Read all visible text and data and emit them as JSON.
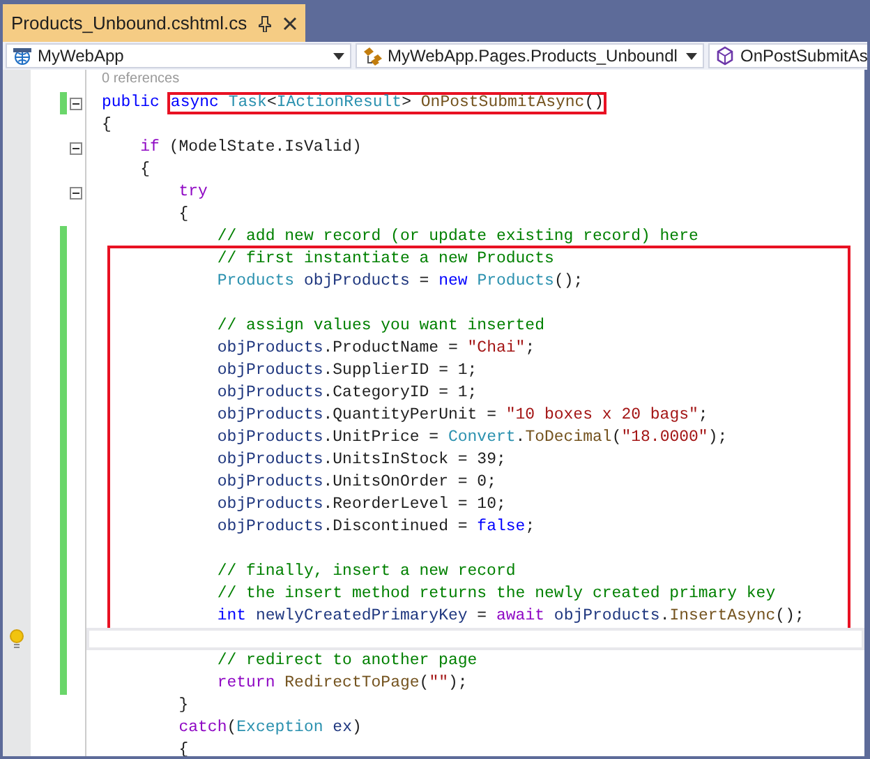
{
  "tab": {
    "title": "Products_Unbound.cshtml.cs",
    "selected": true
  },
  "navigation_bar": [
    {
      "kind": "project",
      "text": "MyWebApp"
    },
    {
      "kind": "class",
      "text": "MyWebApp.Pages.Products_Unboundl"
    },
    {
      "kind": "method",
      "text": "OnPostSubmitAs"
    }
  ],
  "code_lens": "0 references",
  "lines": [
    {
      "kind": "line",
      "changed": true,
      "foldable": true,
      "tokens": [
        {
          "kind": "kw",
          "text": "public"
        }
      ],
      "highlighted_tokens": [
        {
          "kind": "kw",
          "text": "async"
        },
        {
          "kind": "type",
          "text": " Task"
        },
        {
          "kind": "plain",
          "text": "<"
        },
        {
          "kind": "type",
          "text": "IActionResult"
        },
        {
          "kind": "plain",
          "text": "> "
        },
        {
          "kind": "method",
          "text": "OnPostSubmitAsync"
        },
        {
          "kind": "plain",
          "text": "()"
        }
      ]
    },
    {
      "kind": "line",
      "tokens": [
        {
          "kind": "plain",
          "text": "{"
        }
      ],
      "children": [
        {
          "kind": "line",
          "foldable": true,
          "tokens": [
            {
              "kind": "ctl",
              "text": "if"
            },
            {
              "kind": "plain",
              "text": " (ModelState.IsValid)"
            }
          ]
        },
        {
          "kind": "line",
          "tokens": [
            {
              "kind": "plain",
              "text": "{"
            }
          ],
          "children": [
            {
              "kind": "line",
              "foldable": true,
              "tokens": [
                {
                  "kind": "ctl",
                  "text": "try"
                }
              ]
            },
            {
              "kind": "line",
              "tokens": [
                {
                  "kind": "plain",
                  "text": "{"
                }
              ],
              "children": [
                {
                  "kind": "line",
                  "changed": true,
                  "tokens": [
                    {
                      "kind": "cmt",
                      "text": "// add new record (or update existing record) here"
                    }
                  ]
                },
                {
                  "kind": "highlight_box",
                  "children": [
                    {
                      "kind": "line",
                      "changed": true,
                      "tokens": [
                        {
                          "kind": "cmt",
                          "text": "// first instantiate a new Products"
                        }
                      ]
                    },
                    {
                      "kind": "line",
                      "changed": true,
                      "tokens": [
                        {
                          "kind": "type",
                          "text": "Products"
                        },
                        {
                          "kind": "local",
                          "text": " objProducts"
                        },
                        {
                          "kind": "plain",
                          "text": " = "
                        },
                        {
                          "kind": "kw",
                          "text": "new"
                        },
                        {
                          "kind": "type",
                          "text": " Products"
                        },
                        {
                          "kind": "plain",
                          "text": "();"
                        }
                      ]
                    },
                    {
                      "kind": "line",
                      "changed": true
                    },
                    {
                      "kind": "line",
                      "changed": true,
                      "tokens": [
                        {
                          "kind": "cmt",
                          "text": "// assign values you want inserted"
                        }
                      ]
                    },
                    {
                      "kind": "line",
                      "changed": true,
                      "tokens": [
                        {
                          "kind": "local",
                          "text": "objProducts"
                        },
                        {
                          "kind": "plain",
                          "text": ".ProductName = "
                        },
                        {
                          "kind": "str",
                          "text": "\"Chai\""
                        },
                        {
                          "kind": "plain",
                          "text": ";"
                        }
                      ]
                    },
                    {
                      "kind": "line",
                      "changed": true,
                      "tokens": [
                        {
                          "kind": "local",
                          "text": "objProducts"
                        },
                        {
                          "kind": "plain",
                          "text": ".SupplierID = 1;"
                        }
                      ]
                    },
                    {
                      "kind": "line",
                      "changed": true,
                      "tokens": [
                        {
                          "kind": "local",
                          "text": "objProducts"
                        },
                        {
                          "kind": "plain",
                          "text": ".CategoryID = 1;"
                        }
                      ]
                    },
                    {
                      "kind": "line",
                      "changed": true,
                      "tokens": [
                        {
                          "kind": "local",
                          "text": "objProducts"
                        },
                        {
                          "kind": "plain",
                          "text": ".QuantityPerUnit = "
                        },
                        {
                          "kind": "str",
                          "text": "\"10 boxes x 20 bags\""
                        },
                        {
                          "kind": "plain",
                          "text": ";"
                        }
                      ]
                    },
                    {
                      "kind": "line",
                      "changed": true,
                      "tokens": [
                        {
                          "kind": "local",
                          "text": "objProducts"
                        },
                        {
                          "kind": "plain",
                          "text": ".UnitPrice = "
                        },
                        {
                          "kind": "type",
                          "text": "Convert"
                        },
                        {
                          "kind": "plain",
                          "text": "."
                        },
                        {
                          "kind": "method",
                          "text": "ToDecimal"
                        },
                        {
                          "kind": "plain",
                          "text": "("
                        },
                        {
                          "kind": "str",
                          "text": "\"18.0000\""
                        },
                        {
                          "kind": "plain",
                          "text": ");"
                        }
                      ]
                    },
                    {
                      "kind": "line",
                      "changed": true,
                      "tokens": [
                        {
                          "kind": "local",
                          "text": "objProducts"
                        },
                        {
                          "kind": "plain",
                          "text": ".UnitsInStock = 39;"
                        }
                      ]
                    },
                    {
                      "kind": "line",
                      "changed": true,
                      "tokens": [
                        {
                          "kind": "local",
                          "text": "objProducts"
                        },
                        {
                          "kind": "plain",
                          "text": ".UnitsOnOrder = 0;"
                        }
                      ]
                    },
                    {
                      "kind": "line",
                      "changed": true,
                      "tokens": [
                        {
                          "kind": "local",
                          "text": "objProducts"
                        },
                        {
                          "kind": "plain",
                          "text": ".ReorderLevel = 10;"
                        }
                      ]
                    },
                    {
                      "kind": "line",
                      "changed": true,
                      "tokens": [
                        {
                          "kind": "local",
                          "text": "objProducts"
                        },
                        {
                          "kind": "plain",
                          "text": ".Discontinued = "
                        },
                        {
                          "kind": "kw",
                          "text": "false"
                        },
                        {
                          "kind": "plain",
                          "text": ";"
                        }
                      ]
                    },
                    {
                      "kind": "line",
                      "changed": true
                    },
                    {
                      "kind": "line",
                      "changed": true,
                      "tokens": [
                        {
                          "kind": "cmt",
                          "text": "// finally, insert a new record"
                        }
                      ]
                    },
                    {
                      "kind": "line",
                      "changed": true,
                      "tokens": [
                        {
                          "kind": "cmt",
                          "text": "// the insert method returns the newly created primary key"
                        }
                      ]
                    },
                    {
                      "kind": "line",
                      "changed": true,
                      "tokens": [
                        {
                          "kind": "kw",
                          "text": "int"
                        },
                        {
                          "kind": "local",
                          "text": " newlyCreatedPrimaryKey"
                        },
                        {
                          "kind": "plain",
                          "text": " = "
                        },
                        {
                          "kind": "ctl",
                          "text": "await"
                        },
                        {
                          "kind": "local",
                          "text": " objProducts"
                        },
                        {
                          "kind": "plain",
                          "text": "."
                        },
                        {
                          "kind": "method",
                          "text": "InsertAsync"
                        },
                        {
                          "kind": "plain",
                          "text": "();"
                        }
                      ]
                    }
                  ]
                },
                {
                  "kind": "line",
                  "changed": true,
                  "current": true,
                  "lightbulb": true
                },
                {
                  "kind": "line",
                  "changed": true,
                  "tokens": [
                    {
                      "kind": "cmt",
                      "text": "// redirect to another page"
                    }
                  ]
                },
                {
                  "kind": "line",
                  "changed": true,
                  "tokens": [
                    {
                      "kind": "ctl",
                      "text": "return"
                    },
                    {
                      "kind": "method",
                      "text": " RedirectToPage"
                    },
                    {
                      "kind": "plain",
                      "text": "("
                    },
                    {
                      "kind": "str",
                      "text": "\"\""
                    },
                    {
                      "kind": "plain",
                      "text": ");"
                    }
                  ]
                }
              ]
            },
            {
              "kind": "line",
              "tokens": [
                {
                  "kind": "plain",
                  "text": "}"
                }
              ]
            },
            {
              "kind": "line",
              "tokens": [
                {
                  "kind": "ctl",
                  "text": "catch"
                },
                {
                  "kind": "plain",
                  "text": "("
                },
                {
                  "kind": "type",
                  "text": "Exception"
                },
                {
                  "kind": "local",
                  "text": " ex"
                },
                {
                  "kind": "plain",
                  "text": ")"
                }
              ]
            },
            {
              "kind": "line",
              "tokens": [
                {
                  "kind": "plain",
                  "text": "{"
                }
              ]
            }
          ]
        }
      ]
    }
  ]
}
